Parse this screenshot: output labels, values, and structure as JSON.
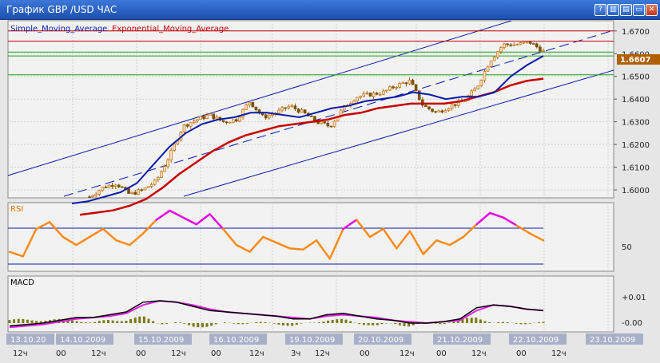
{
  "window": {
    "title": "График GBP /USD  ЧАС",
    "buttons": {
      "help": "?",
      "tile": "▥",
      "layout": "▤",
      "minimize": "▭",
      "close": "✕"
    }
  },
  "legend": {
    "sma": "Simple_Moving_Average",
    "ema": "Exponential_Moving_Average"
  },
  "colors": {
    "sma": "#0a1aa8",
    "ema": "#c80000",
    "candle_up": "#c06000",
    "candle_down": "#7a5000",
    "rsi": "#ff8a1a",
    "rsi_high": "#e800e8",
    "rsi_low": "#40d040",
    "macd": "#000000",
    "signal": "#e020e0",
    "hist": "#7a7a14",
    "channel": "#0a1aa8",
    "res_line": "#c00000",
    "sup_line": "#1aa01a",
    "price_badge": "#b06000"
  },
  "price_panel": {
    "ticks": [
      "1.6700",
      "1.6600",
      "1.6500",
      "1.6400",
      "1.6300",
      "1.6200",
      "1.6100",
      "1.6000"
    ],
    "current_price": "1.6607"
  },
  "rsi_panel": {
    "label": "RSI",
    "tick": "50"
  },
  "macd_panel": {
    "label": "MACD",
    "ticks": [
      "+0.01",
      "-0.00"
    ]
  },
  "time_axis": {
    "dates": [
      "13.10.20",
      "14.10.2009",
      "15.10.2009",
      "16.10.2009",
      "19.10.2009",
      "20.10.2009",
      "21.10.2009",
      "22.10.2009",
      "23.10.2009"
    ],
    "hours": [
      "12ч",
      "00",
      "12ч",
      "00",
      "12ч",
      "00",
      "12ч",
      "3ч",
      "12ч",
      "00",
      "12ч",
      "00",
      "12ч",
      "00",
      "12ч"
    ]
  },
  "chart_data": {
    "type": "line",
    "title": "График GBP /USD  ЧАС",
    "y_range": [
      1.5965,
      1.6745
    ],
    "current_price": 1.6607,
    "horizontal_levels": {
      "resistance": [
        1.67,
        1.6655
      ],
      "support": [
        1.6607,
        1.659,
        1.6507
      ]
    },
    "price_anchors": [
      1.597,
      1.601,
      1.603,
      1.598,
      1.6,
      1.604,
      1.615,
      1.628,
      1.631,
      1.633,
      1.63,
      1.631,
      1.639,
      1.632,
      1.634,
      1.637,
      1.634,
      1.63,
      1.628,
      1.636,
      1.641,
      1.642,
      1.643,
      1.646,
      1.648,
      1.637,
      1.634,
      1.637,
      1.639,
      1.645,
      1.657,
      1.664,
      1.664,
      1.665,
      1.661
    ],
    "series": [
      {
        "name": "Simple_Moving_Average",
        "values": [
          1.594,
          1.595,
          1.597,
          1.599,
          1.603,
          1.611,
          1.619,
          1.625,
          1.629,
          1.631,
          1.632,
          1.634,
          1.634,
          1.633,
          1.632,
          1.634,
          1.636,
          1.637,
          1.639,
          1.64,
          1.641,
          1.643,
          1.642,
          1.64,
          1.641,
          1.641,
          1.643,
          1.65,
          1.655,
          1.659
        ]
      },
      {
        "name": "Exponential_Moving_Average",
        "values": [
          1.589,
          1.59,
          1.591,
          1.593,
          1.596,
          1.601,
          1.607,
          1.612,
          1.617,
          1.621,
          1.624,
          1.626,
          1.628,
          1.629,
          1.63,
          1.631,
          1.633,
          1.634,
          1.636,
          1.637,
          1.638,
          1.638,
          1.638,
          1.639,
          1.641,
          1.643,
          1.646,
          1.648,
          1.649
        ]
      }
    ],
    "rsi": [
      42,
      38,
      62,
      68,
      55,
      48,
      55,
      62,
      52,
      48,
      58,
      70,
      78,
      72,
      66,
      75,
      62,
      48,
      42,
      55,
      50,
      45,
      44,
      52,
      36,
      62,
      70,
      55,
      62,
      45,
      60,
      40,
      52,
      48,
      55,
      66,
      76,
      72,
      65,
      58,
      52
    ],
    "macd": [
      -0.002,
      -0.001,
      0.0,
      0.002,
      0.004,
      0.004,
      0.006,
      0.008,
      0.015,
      0.016,
      0.015,
      0.012,
      0.009,
      0.008,
      0.007,
      0.006,
      0.005,
      0.003,
      0.003,
      0.006,
      0.007,
      0.005,
      0.003,
      0.002,
      0.0,
      0.0,
      0.001,
      0.003,
      0.011,
      0.013,
      0.012,
      0.01,
      0.009
    ],
    "macd_signal": [
      -0.003,
      -0.002,
      -0.001,
      0.001,
      0.003,
      0.004,
      0.005,
      0.007,
      0.013,
      0.016,
      0.015,
      0.013,
      0.01,
      0.008,
      0.007,
      0.006,
      0.005,
      0.004,
      0.003,
      0.005,
      0.006,
      0.005,
      0.004,
      0.002,
      0.001,
      0.0,
      0.001,
      0.002,
      0.009,
      0.013,
      0.012,
      0.01,
      0.009
    ]
  }
}
